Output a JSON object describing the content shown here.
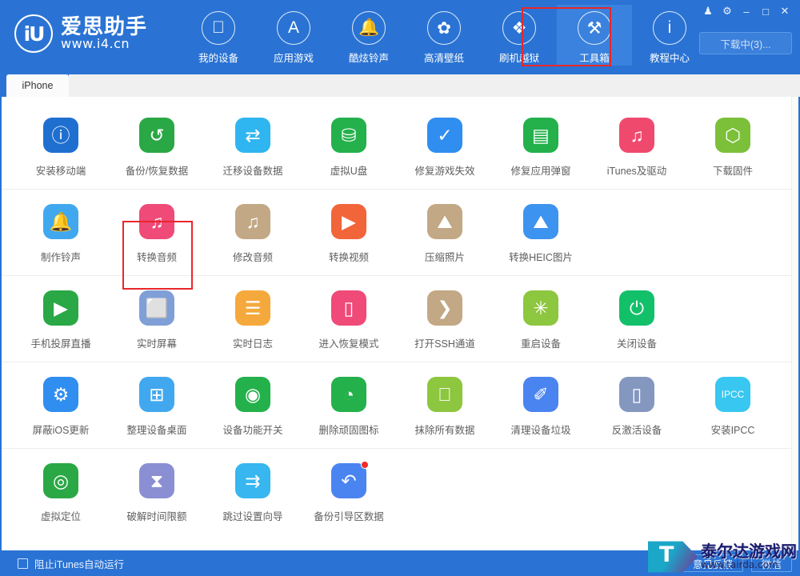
{
  "window": {
    "controls": [
      {
        "name": "skin-icon",
        "glyph": "♟"
      },
      {
        "name": "settings-gear-icon",
        "glyph": "⚙"
      },
      {
        "name": "minimize-icon",
        "glyph": "–"
      },
      {
        "name": "maximize-icon",
        "glyph": "□"
      },
      {
        "name": "close-icon",
        "glyph": "✕"
      }
    ]
  },
  "brand": {
    "mark": "iU",
    "name_cn": "爱思助手",
    "url": "www.i4.cn"
  },
  "header": {
    "download_button": "下载中(3)...",
    "nav": [
      {
        "label": "我的设备",
        "icon": "apple-icon",
        "glyph": "",
        "active": false
      },
      {
        "label": "应用游戏",
        "icon": "appstore-icon",
        "glyph": "A",
        "active": false
      },
      {
        "label": "酷炫铃声",
        "icon": "bell-icon",
        "glyph": "🔔",
        "active": false
      },
      {
        "label": "高清壁纸",
        "icon": "flower-wallpaper-icon",
        "glyph": "✿",
        "active": false
      },
      {
        "label": "刷机越狱",
        "icon": "dropbox-flash-icon",
        "glyph": "❖",
        "active": false
      },
      {
        "label": "工具箱",
        "icon": "toolbox-wrench-icon",
        "glyph": "⚒",
        "active": true
      },
      {
        "label": "教程中心",
        "icon": "info-icon",
        "glyph": "i",
        "active": false
      }
    ]
  },
  "tabs": [
    {
      "label": "iPhone",
      "active": true
    }
  ],
  "toolbox": {
    "rows": [
      [
        {
          "label": "安装移动端",
          "icon": "i4-app-icon",
          "glyph": "ⓘ",
          "bg": "#1f6fd0",
          "highlight": false
        },
        {
          "label": "备份/恢复数据",
          "icon": "backup-restore-icon",
          "glyph": "↺",
          "bg": "#2aa845",
          "highlight": true
        },
        {
          "label": "迁移设备数据",
          "icon": "device-migrate-icon",
          "glyph": "⇄",
          "bg": "#2fb5f0",
          "highlight": false
        },
        {
          "label": "虚拟U盘",
          "icon": "usb-drive-icon",
          "glyph": "⛁",
          "bg": "#24b14c",
          "highlight": false
        },
        {
          "label": "修复游戏失效",
          "icon": "fix-game-icon",
          "glyph": "✓",
          "bg": "#2f8ef0",
          "highlight": false
        },
        {
          "label": "修复应用弹窗",
          "icon": "appleid-popup-icon",
          "glyph": "▤",
          "bg": "#24b14c",
          "highlight": false
        },
        {
          "label": "iTunes及驱动",
          "icon": "itunes-driver-icon",
          "glyph": "♫",
          "bg": "#ef4a6e",
          "highlight": false
        },
        {
          "label": "下载固件",
          "icon": "firmware-box-icon",
          "glyph": "⬡",
          "bg": "#7cc03a",
          "highlight": false
        }
      ],
      [
        {
          "label": "制作铃声",
          "icon": "make-ringtone-icon",
          "glyph": "🔔",
          "bg": "#41a8ef",
          "highlight": false
        },
        {
          "label": "转换音频",
          "icon": "convert-audio-icon",
          "glyph": "♫",
          "bg": "#ef4a78",
          "highlight": false
        },
        {
          "label": "修改音频",
          "icon": "edit-audio-icon",
          "glyph": "♫",
          "bg": "#c2a884",
          "highlight": false
        },
        {
          "label": "转换视频",
          "icon": "convert-video-icon",
          "glyph": "▶",
          "bg": "#f2653a",
          "highlight": false
        },
        {
          "label": "压缩照片",
          "icon": "compress-photo-icon",
          "glyph": "⛰",
          "bg": "#c2a884",
          "highlight": false
        },
        {
          "label": "转换HEIC图片",
          "icon": "convert-heic-icon",
          "glyph": "⛰",
          "bg": "#3d93f0",
          "highlight": false
        }
      ],
      [
        {
          "label": "手机投屏直播",
          "icon": "screen-cast-icon",
          "glyph": "▶",
          "bg": "#2aa845",
          "highlight": false
        },
        {
          "label": "实时屏幕",
          "icon": "live-screen-icon",
          "glyph": "⬜",
          "bg": "#7f9fd6",
          "highlight": false
        },
        {
          "label": "实时日志",
          "icon": "live-log-icon",
          "glyph": "☰",
          "bg": "#f5a93c",
          "highlight": false
        },
        {
          "label": "进入恢复模式",
          "icon": "recovery-mode-icon",
          "glyph": "▯",
          "bg": "#ef4a78",
          "highlight": false
        },
        {
          "label": "打开SSH通道",
          "icon": "ssh-terminal-icon",
          "glyph": "❯",
          "bg": "#c2a884",
          "highlight": false
        },
        {
          "label": "重启设备",
          "icon": "restart-device-icon",
          "glyph": "✳",
          "bg": "#8dc63f",
          "highlight": false
        },
        {
          "label": "关闭设备",
          "icon": "power-off-icon",
          "glyph": "⏻",
          "bg": "#13c06a",
          "highlight": false
        }
      ],
      [
        {
          "label": "屏蔽iOS更新",
          "icon": "block-ios-update-icon",
          "glyph": "⚙",
          "bg": "#2f8ef0",
          "highlight": false
        },
        {
          "label": "整理设备桌面",
          "icon": "organize-desktop-icon",
          "glyph": "⊞",
          "bg": "#41a8ef",
          "highlight": false
        },
        {
          "label": "设备功能开关",
          "icon": "feature-toggle-icon",
          "glyph": "◉",
          "bg": "#24b14c",
          "highlight": false
        },
        {
          "label": "删除顽固图标",
          "icon": "delete-stubborn-icon",
          "glyph": "◔",
          "bg": "#24b14c",
          "highlight": false
        },
        {
          "label": "抹除所有数据",
          "icon": "erase-all-icon",
          "glyph": "",
          "bg": "#8dc63f",
          "highlight": false
        },
        {
          "label": "清理设备垃圾",
          "icon": "clean-junk-icon",
          "glyph": "✐",
          "bg": "#4a84f0",
          "highlight": false
        },
        {
          "label": "反激活设备",
          "icon": "deactivate-device-icon",
          "glyph": "▯",
          "bg": "#8497bf",
          "highlight": false
        },
        {
          "label": "安装IPCC",
          "icon": "install-ipcc-icon",
          "glyph": "IPCC",
          "bg": "#37c7f0",
          "highlight": false
        }
      ],
      [
        {
          "label": "虚拟定位",
          "icon": "virtual-location-icon",
          "glyph": "◎",
          "bg": "#2aa845",
          "highlight": false
        },
        {
          "label": "破解时间限额",
          "icon": "crack-screentime-icon",
          "glyph": "⧗",
          "bg": "#8a8fd4",
          "highlight": false
        },
        {
          "label": "跳过设置向导",
          "icon": "skip-setup-icon",
          "glyph": "⇉",
          "bg": "#37b6f0",
          "highlight": false
        },
        {
          "label": "备份引导区数据",
          "icon": "backup-boot-icon",
          "glyph": "↶",
          "bg": "#4a84f0",
          "highlight": false,
          "badge": true
        }
      ]
    ]
  },
  "statusbar": {
    "checkbox_label": "阻止iTunes自动运行",
    "checkbox_checked": false,
    "buttons": [
      {
        "label": "意见反馈",
        "name": "feedback-button"
      },
      {
        "label": "微信",
        "name": "wechat-button"
      }
    ]
  },
  "watermark": {
    "mark": "T",
    "name_cn": "泰尔达游戏网",
    "url": "www.tairda.com"
  },
  "colors": {
    "header_blue": "#2a73d4",
    "accent_red": "#e8272b",
    "content_bg": "#ffffff"
  }
}
